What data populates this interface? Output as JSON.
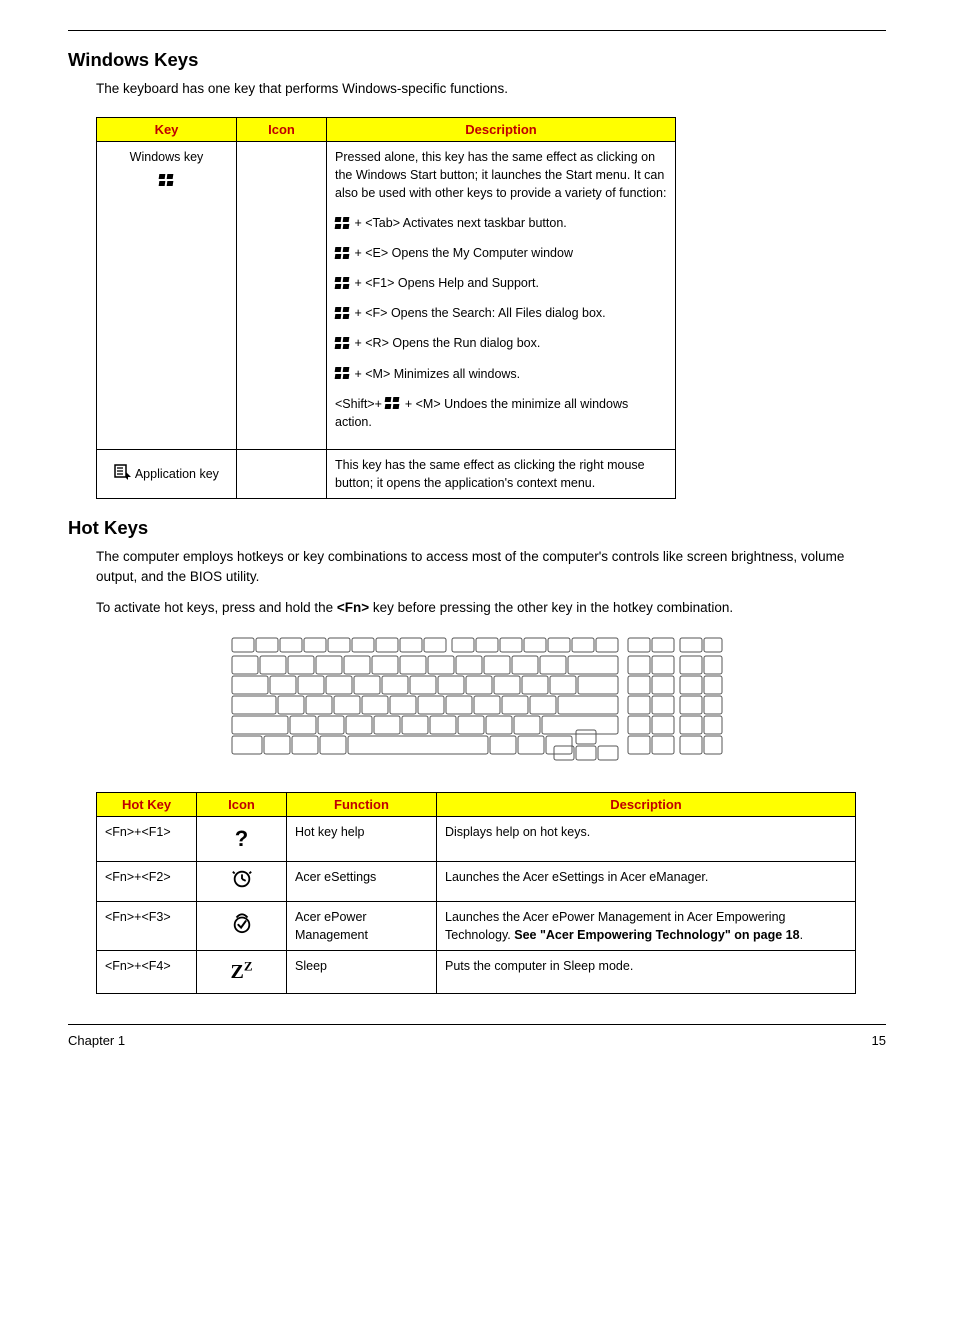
{
  "section1": {
    "heading": "Windows Keys",
    "lead": "The keyboard has one key that performs Windows-specific functions."
  },
  "winTable": {
    "headers": {
      "key": "Key",
      "icon": "Icon",
      "desc": "Description"
    },
    "row1": {
      "key": "Windows key",
      "p1": "Pressed alone, this key has the same effect as clicking on the Windows Start button; it launches the Start menu. It can also be used with other keys to provide a variety of function:",
      "l1": " + <Tab> Activates next taskbar button.",
      "l2": " +  <E> Opens the My Computer window",
      "l3": " +  <F1> Opens Help and Support.",
      "l4": " +  <F> Opens the Search: All Files dialog box.",
      "l5": " +  <R> Opens the Run dialog box.",
      "l6": " +   <M> Minimizes all windows.",
      "l7p": "<Shift>+ ",
      "l7s": " + <M> Undoes the minimize all windows action."
    },
    "row2": {
      "key": " Application key",
      "desc": "This key has the same effect as clicking the right mouse button; it opens the application's context menu."
    }
  },
  "section2": {
    "heading": "Hot Keys",
    "lead1": "The computer employs hotkeys or key combinations to access most of the computer's controls like screen brightness, volume output, and the BIOS utility.",
    "lead2_a": "To activate hot keys, press and hold the ",
    "lead2_b": "<Fn>",
    "lead2_c": " key before pressing the other key in the hotkey combination."
  },
  "hotTable": {
    "headers": {
      "hk": "Hot Key",
      "icon": "Icon",
      "fn": "Function",
      "desc": "Description"
    },
    "rows": [
      {
        "hk": "<Fn>+<F1>",
        "fn": "Hot key help",
        "desc": "Displays help on hot keys."
      },
      {
        "hk": "<Fn>+<F2>",
        "fn": "Acer eSettings",
        "desc": "Launches the Acer eSettings in Acer eManager."
      },
      {
        "hk": "<Fn>+<F3>",
        "fn": "Acer ePower Management",
        "desc_a": "Launches the Acer ePower Management in Acer Empowering Technology. ",
        "desc_b": "See \"Acer Empowering Technology\" on page 18",
        "desc_c": "."
      },
      {
        "hk": "<Fn>+<F4>",
        "fn": "Sleep",
        "desc": "Puts the computer in Sleep mode."
      }
    ]
  },
  "footer": {
    "chapter": "Chapter 1",
    "page": "15"
  }
}
